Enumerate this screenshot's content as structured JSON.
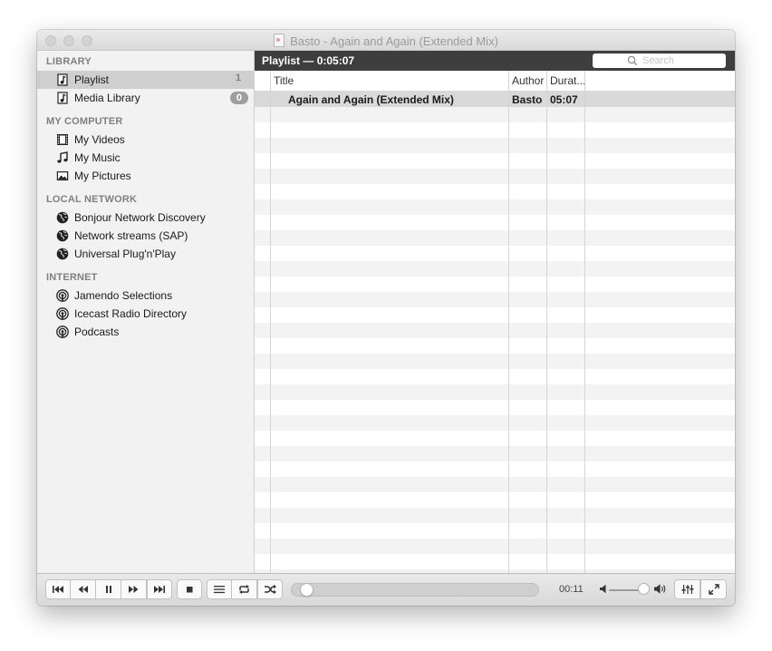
{
  "window": {
    "title": "Basto - Again and Again (Extended Mix)"
  },
  "sidebar": {
    "sections": [
      {
        "title": "LIBRARY",
        "items": [
          {
            "label": "Playlist",
            "icon": "playlist-icon",
            "badge": "1",
            "selected": true
          },
          {
            "label": "Media Library",
            "icon": "media-library-icon",
            "badge": "0"
          }
        ]
      },
      {
        "title": "MY COMPUTER",
        "items": [
          {
            "label": "My Videos",
            "icon": "film-icon"
          },
          {
            "label": "My Music",
            "icon": "music-note-icon"
          },
          {
            "label": "My Pictures",
            "icon": "picture-icon"
          }
        ]
      },
      {
        "title": "LOCAL NETWORK",
        "items": [
          {
            "label": "Bonjour Network Discovery",
            "icon": "network-globe-icon"
          },
          {
            "label": "Network streams (SAP)",
            "icon": "network-globe-icon"
          },
          {
            "label": "Universal Plug'n'Play",
            "icon": "network-globe-icon"
          }
        ]
      },
      {
        "title": "INTERNET",
        "items": [
          {
            "label": "Jamendo Selections",
            "icon": "podcast-icon"
          },
          {
            "label": "Icecast Radio Directory",
            "icon": "podcast-icon"
          },
          {
            "label": "Podcasts",
            "icon": "podcast-icon"
          }
        ]
      }
    ]
  },
  "playlist": {
    "header": "Playlist — 0:05:07",
    "search_placeholder": "Search",
    "columns": {
      "title": "Title",
      "author": "Author",
      "duration": "Durat..."
    },
    "rows": [
      {
        "title": "Again and Again (Extended Mix)",
        "author": "Basto",
        "duration": "05:07",
        "playing": true
      }
    ]
  },
  "controls": {
    "time": "00:11",
    "progress_fraction": 0.035,
    "volume_fraction": 0.9
  }
}
